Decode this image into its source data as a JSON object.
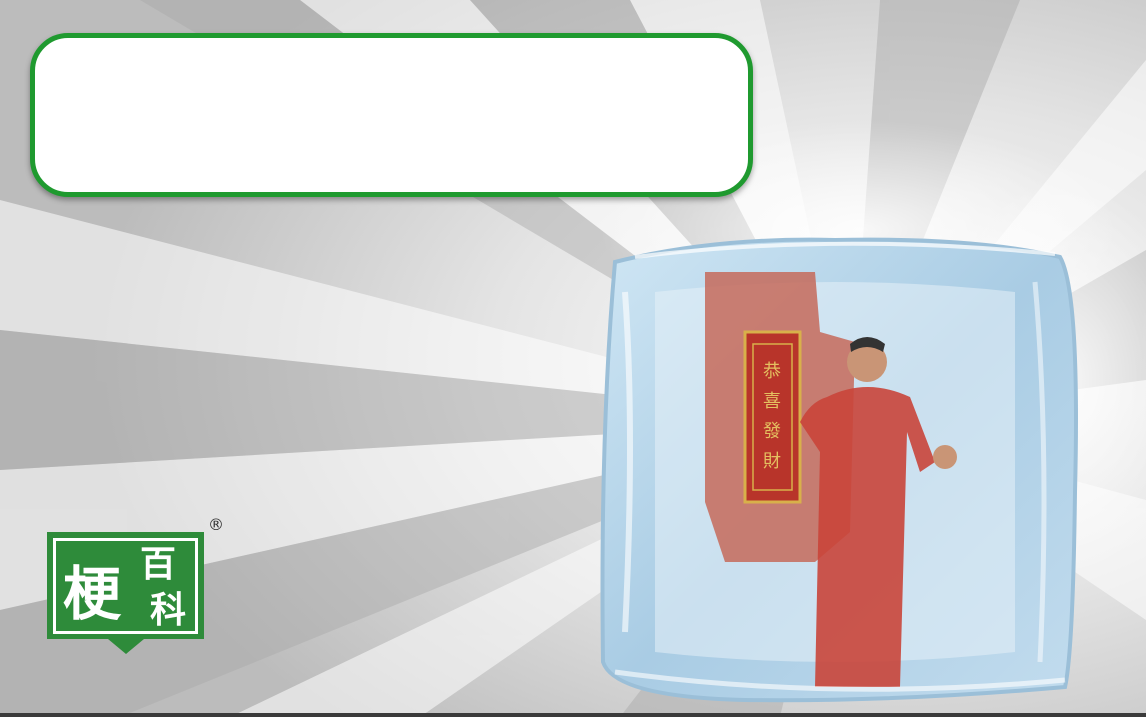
{
  "caption": {
    "text": ""
  },
  "logo": {
    "char_main": "梗",
    "char_top": "百",
    "char_bottom": "科",
    "registered": "®",
    "color": "#2e8b3a"
  },
  "banner": {
    "text": "恭喜發財"
  },
  "colors": {
    "caption_border": "#1f9a2f",
    "robe": "#c9453a",
    "banner_red": "#b8342a",
    "gold": "#d8b04a"
  }
}
